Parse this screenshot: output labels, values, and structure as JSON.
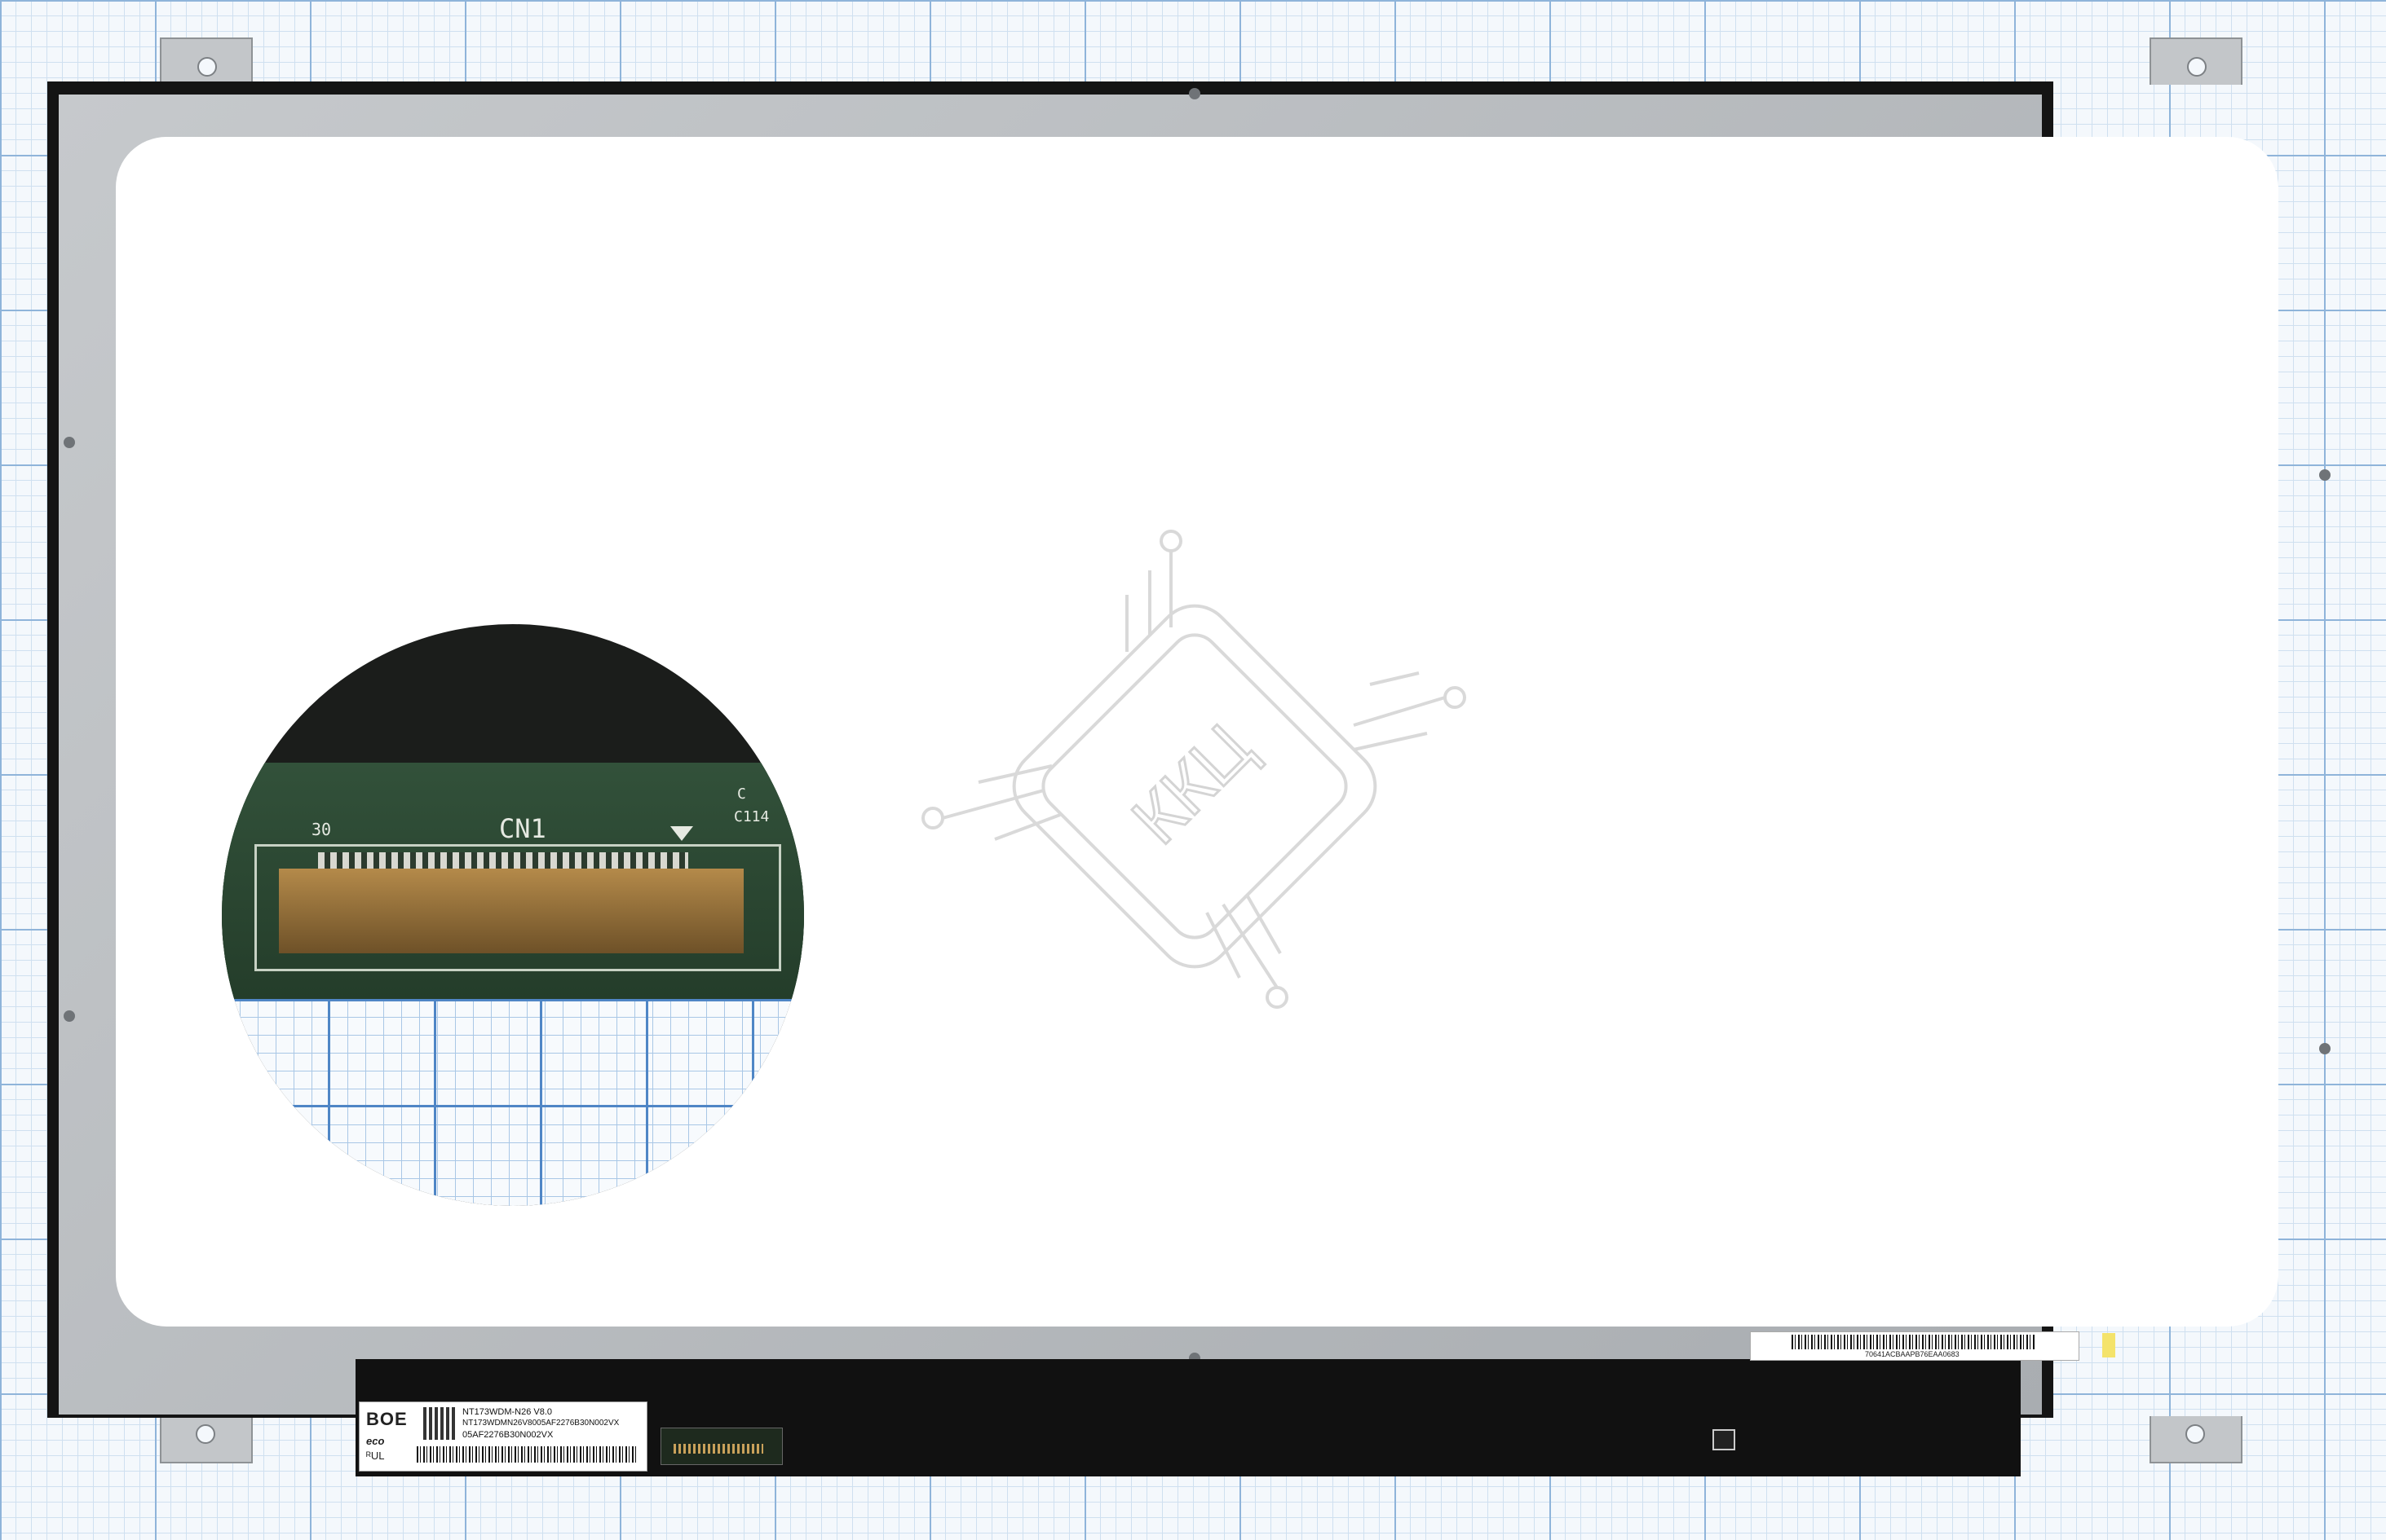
{
  "panel": {
    "brand": "BOE",
    "eco": "eco",
    "ul": "ᴿUL",
    "model_line1": "NT173WDM-N26 V8.0",
    "model_line2": "NT173WDMN26V8005AF2276B30N002VX",
    "model_line3": "05AF2276B30N002VX",
    "serial": "70641ACBAAPB76EAA0683"
  },
  "zoom": {
    "connector_label": "CN1",
    "pin_number": "30",
    "component_label": "C114",
    "component_prefix": "C"
  },
  "watermark": {
    "text": "ККЦ"
  },
  "colors": {
    "bezel": "#b9bcbf",
    "screen": "#ffffff",
    "pcb": "#2d4a33",
    "grid_line": "#8fb4da",
    "watermark": "#d4d4d4"
  }
}
